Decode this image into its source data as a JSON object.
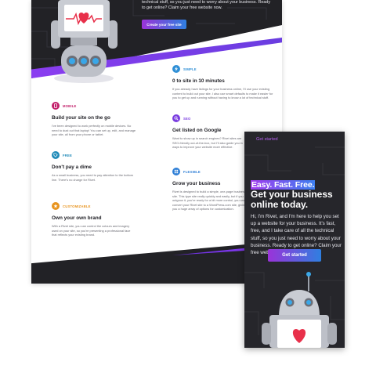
{
  "desktop": {
    "hero": {
      "text": "technical stuff, so you just need to worry about your business. Ready to get online? Claim your free website now.",
      "button_label": "Create your free site"
    },
    "features": [
      {
        "tag": "SIMPLE",
        "title": "0 to site in 10 minutes",
        "desc": "If you already have listings for your business online, I'll use your existing content to build out your site. I also use smart defaults to make it easier for you to get up and running without having to know a lot of technical stuff.",
        "color": "#2f8fd6",
        "icon": "lightning-icon"
      },
      {
        "tag": "MOBILE",
        "title": "Build your site on the go",
        "desc": "I've been designed to work perfectly on mobile devices. No need to dust out that laptop! You can set up, edit, and manage your site, all from your phone or tablet.",
        "color": "#c21f6a",
        "icon": "phone-icon"
      },
      {
        "tag": "SEO",
        "title": "Get listed on Google",
        "desc": "Want to show up in search engines? Rivet sites are SEO-friendly out-of-the-box, but I'll also guide you in ways to improve your website more effective.",
        "color": "#7a3de0",
        "icon": "search-icon"
      },
      {
        "tag": "FREE",
        "title": "Don't pay a dime",
        "desc": "As a small business, you need to pay attention to the bottom line. There's no charge for Rivet.",
        "color": "#1f8ab8",
        "icon": "tag-icon"
      },
      {
        "tag": "FLEXIBLE",
        "title": "Grow your business",
        "desc": "Rivet is designed to build a simple, one-page business site. This type site really quickly and easily, but if you outgrow it, you're ready for a bit more control, you can convert your Rivet site to a WordPress.com site, giving you a huge array of options for customization.",
        "color": "#2f7fd6",
        "icon": "grid-icon"
      },
      {
        "tag": "CUSTOMIZABLE",
        "title": "Own your own brand",
        "desc": "With a Rivet site, you can control the colours and imagery used on your site, so you're presenting a professional face that reflects your existing brand.",
        "color": "#e8941f",
        "icon": "star-icon"
      }
    ]
  },
  "phone": {
    "nav_label": "Get started",
    "eyebrow": "Easy. Fast. Free.",
    "title": "Get your business online today.",
    "body": "Hi, I'm Rivet, and I'm here to help you set up a website for your business. It's fast, free, and I take care of all the technical stuff, so you just need to worry about your business. Ready to get online? Claim your free website now.",
    "button_label": "Get started"
  },
  "colors": {
    "dark_bg": "#222226",
    "accent_purple": "#8a3df0",
    "accent_blue": "#2f7fe0",
    "heart_red": "#e8304a"
  }
}
